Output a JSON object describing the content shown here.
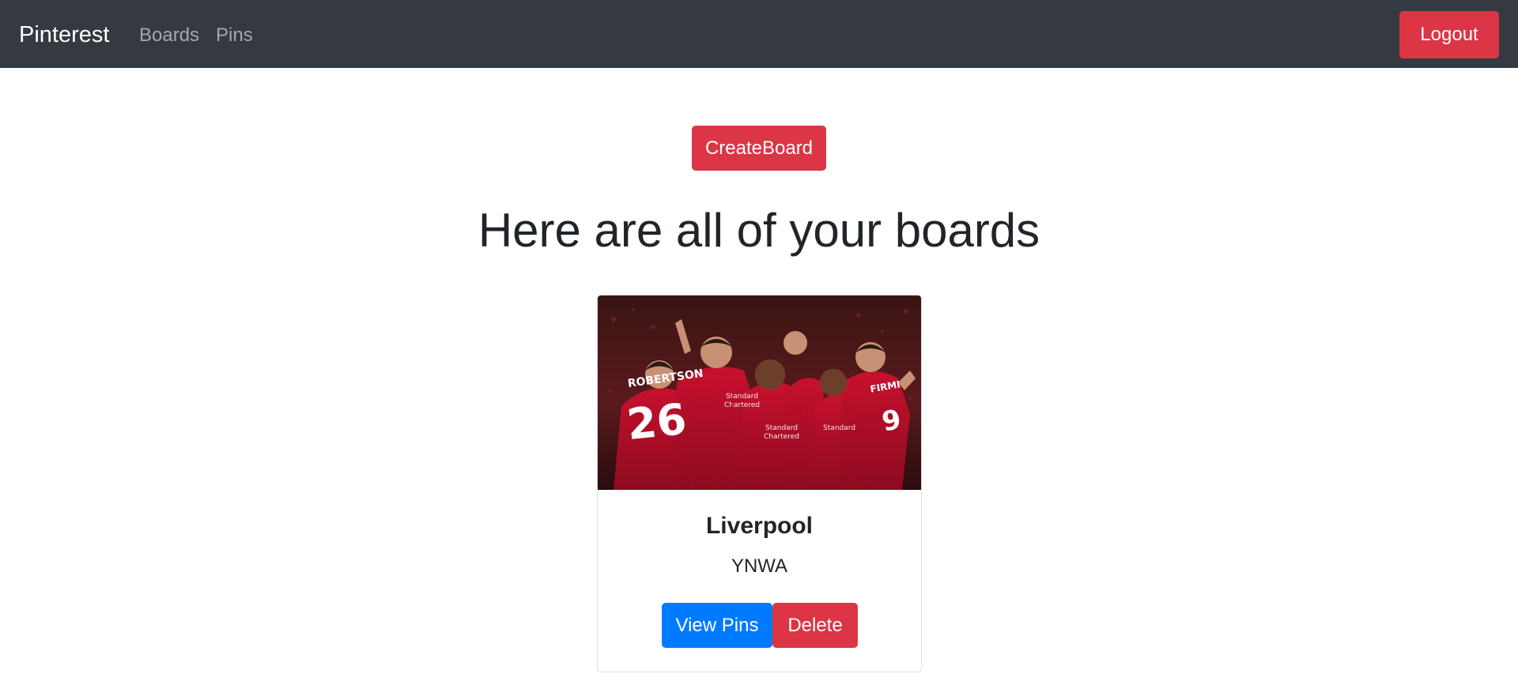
{
  "navbar": {
    "brand": "Pinterest",
    "links": [
      {
        "label": "Boards"
      },
      {
        "label": "Pins"
      }
    ],
    "logout_label": "Logout"
  },
  "main": {
    "create_board_label": "CreateBoard",
    "heading": "Here are all of your boards"
  },
  "boards": [
    {
      "image": "liverpool-players-celebrating-photo",
      "title": "Liverpool",
      "description": "YNWA",
      "view_pins_label": "View Pins",
      "delete_label": "Delete"
    }
  ],
  "colors": {
    "navbar_bg": "#343a40",
    "danger": "#dc3545",
    "primary": "#007bff"
  }
}
